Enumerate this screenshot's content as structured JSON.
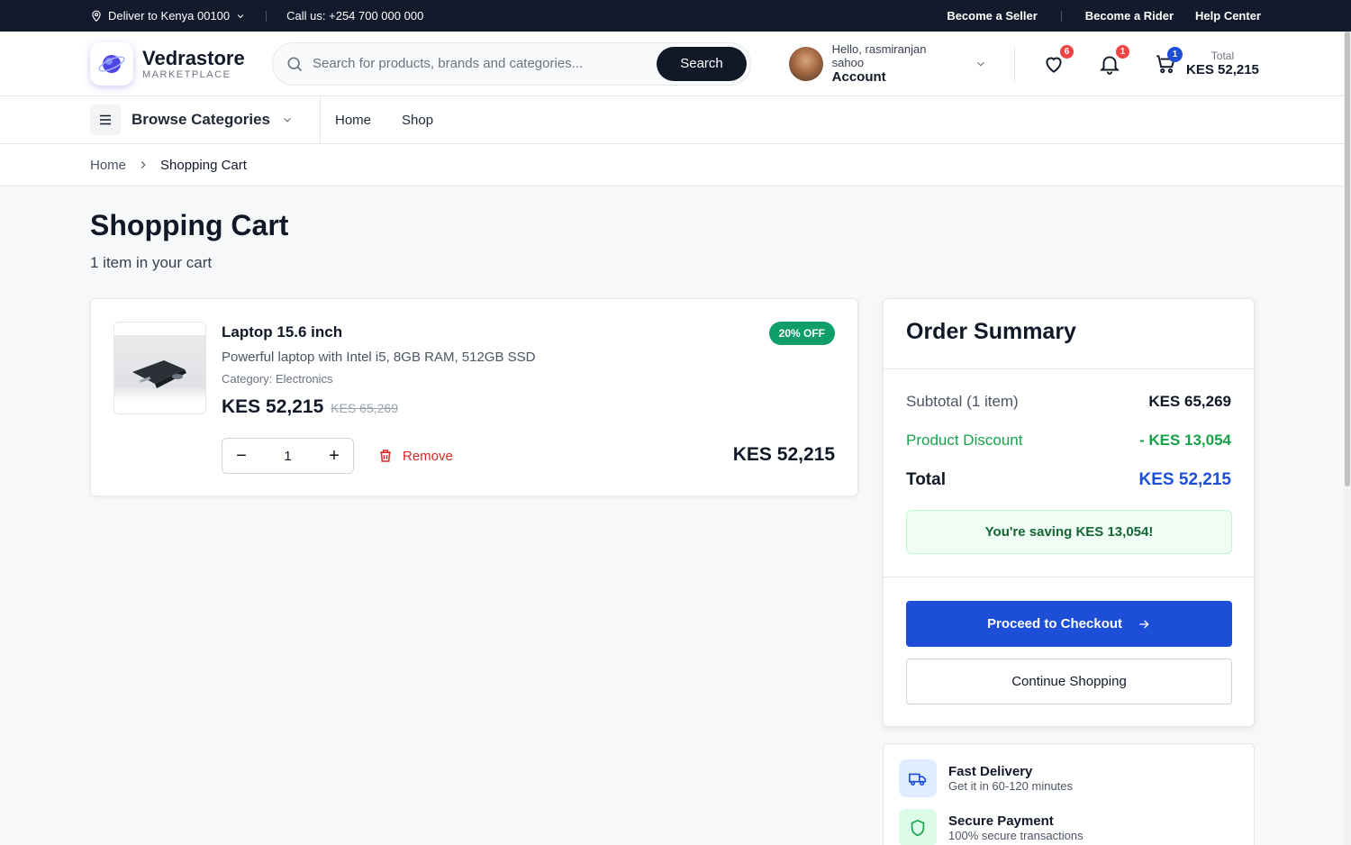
{
  "topbar": {
    "deliver": "Deliver to Kenya 00100",
    "call": "Call us: +254 700 000 000",
    "links": [
      "Become a Seller",
      "Become a Rider",
      "Help Center"
    ]
  },
  "header": {
    "brand": "Vedrastore",
    "brand_sub": "MARKETPLACE",
    "search_placeholder": "Search for products, brands and categories...",
    "search_button": "Search",
    "greeting": "Hello, rasmiranjan sahoo",
    "account_label": "Account",
    "wishlist_count": "6",
    "notification_count": "1",
    "cart_count": "1",
    "total_label": "Total",
    "total_value": "KES 52,215"
  },
  "nav": {
    "browse": "Browse Categories",
    "links": [
      "Home",
      "Shop"
    ]
  },
  "breadcrumb": {
    "home": "Home",
    "current": "Shopping Cart"
  },
  "page": {
    "title": "Shopping Cart",
    "subtitle": "1 item in your cart"
  },
  "cart_item": {
    "name": "Laptop 15.6 inch",
    "description": "Powerful laptop with Intel i5, 8GB RAM, 512GB SSD",
    "category": "Category: Electronics",
    "price": "KES 52,215",
    "old_price": "KES 65,269",
    "discount_badge": "20% OFF",
    "quantity": "1",
    "remove_label": "Remove",
    "line_total": "KES 52,215"
  },
  "summary": {
    "title": "Order Summary",
    "subtotal_label": "Subtotal (1 item)",
    "subtotal_value": "KES 65,269",
    "discount_label": "Product Discount",
    "discount_value": "- KES 13,054",
    "total_label": "Total",
    "total_value": "KES 52,215",
    "saving_text": "You're saving KES 13,054!",
    "checkout": "Proceed to Checkout",
    "continue": "Continue Shopping"
  },
  "features": [
    {
      "title": "Fast Delivery",
      "subtitle": "Get it in 60-120 minutes",
      "icon": "truck-icon"
    },
    {
      "title": "Secure Payment",
      "subtitle": "100% secure transactions",
      "icon": "shield-icon"
    }
  ],
  "colors": {
    "accent": "#1d4ed8",
    "dark": "#121a2c",
    "green": "#16a34a",
    "red": "#dc2626",
    "badge_green": "#0f9d6a"
  }
}
